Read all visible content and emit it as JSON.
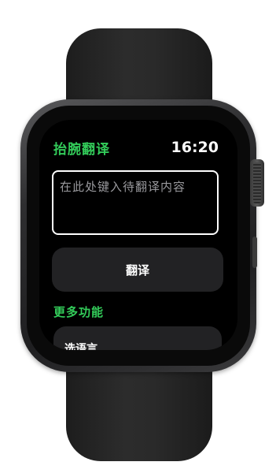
{
  "app": {
    "title": "抬腕翻译",
    "time": "16:20"
  },
  "input": {
    "placeholder": "在此处键入待翻译内容",
    "value": ""
  },
  "actions": {
    "translate_label": "翻译"
  },
  "more": {
    "section_title": "更多功能",
    "items": [
      {
        "label": "选语言"
      }
    ]
  },
  "colors": {
    "accent": "#33cc5a",
    "background": "#000000",
    "button_bg": "#222224",
    "text": "#ffffff",
    "placeholder": "#9a9a9e"
  }
}
